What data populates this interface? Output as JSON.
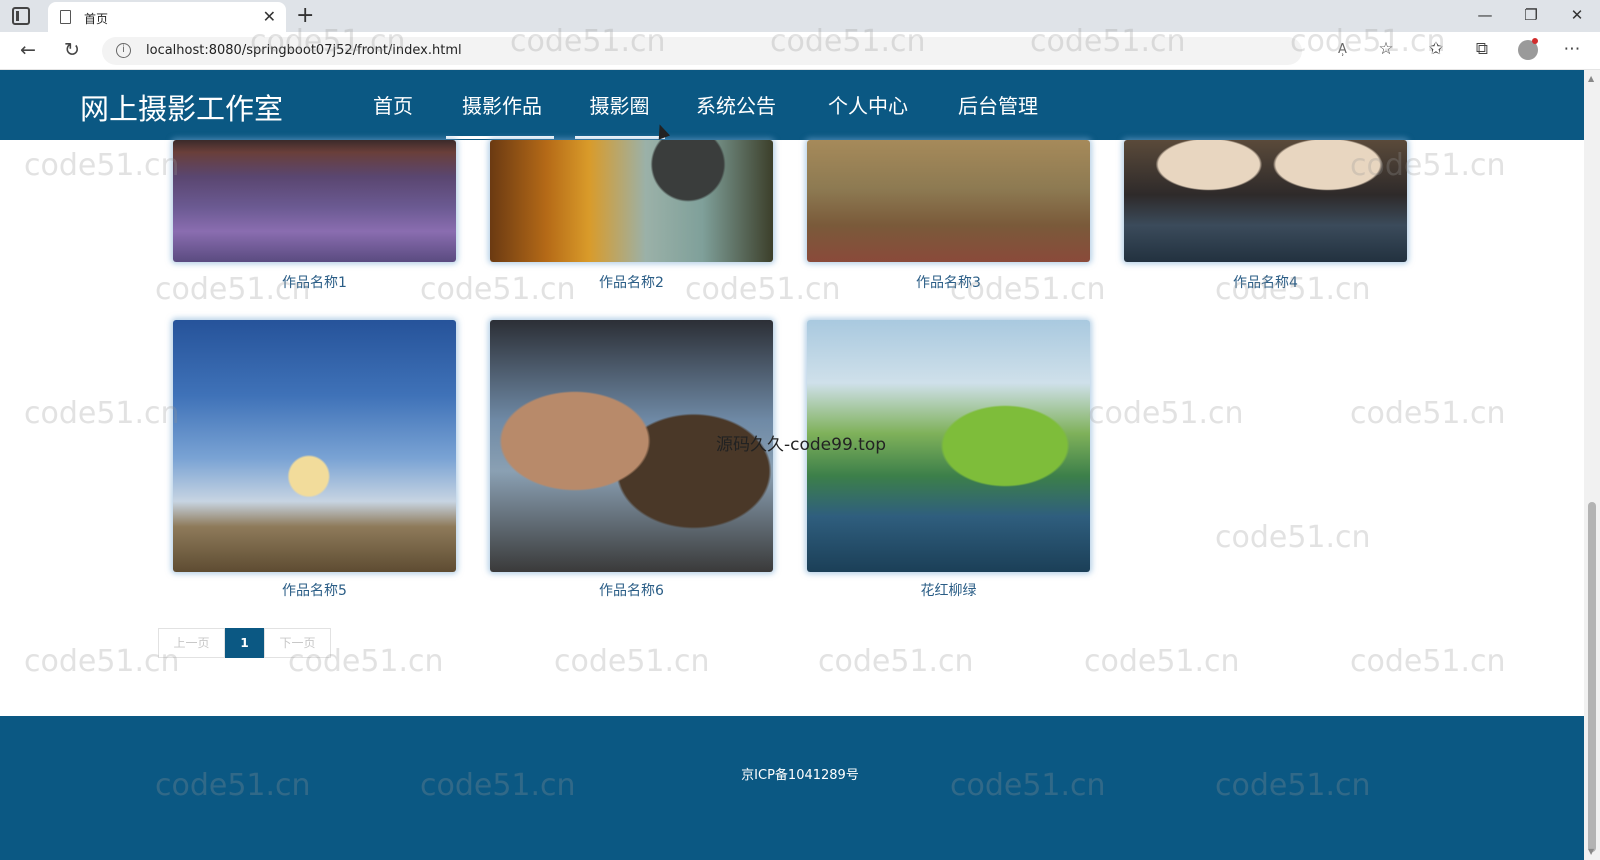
{
  "browser": {
    "tab_title": "首页",
    "url": "localhost:8080/springboot07j52/front/index.html",
    "read_aloud": "A̹"
  },
  "site": {
    "title": "网上摄影工作室",
    "nav": [
      "首页",
      "摄影作品",
      "摄影圈",
      "系统公告",
      "个人中心",
      "后台管理"
    ]
  },
  "works": [
    "作品名称1",
    "作品名称2",
    "作品名称3",
    "作品名称4",
    "作品名称5",
    "作品名称6",
    "花红柳绿"
  ],
  "pagination": {
    "prev": "上一页",
    "current": "1",
    "next": "下一页"
  },
  "footer": {
    "icp": "京ICP备1041289号"
  },
  "overlay": {
    "text": "源码久久-code99.top",
    "watermark": "code51.cn"
  },
  "colors": {
    "primary": "#0b5883",
    "caption": "#2a5d86"
  }
}
